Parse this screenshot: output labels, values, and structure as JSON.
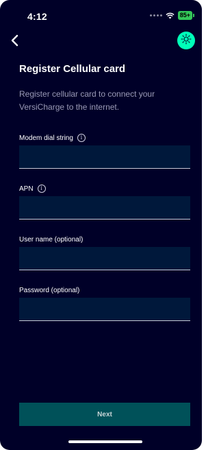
{
  "status_bar": {
    "time": "4:12",
    "battery": "85+"
  },
  "icons": {
    "back": "chevron-left-icon",
    "brightness": "sun-icon",
    "info": "info-icon"
  },
  "colors": {
    "background": "#000028",
    "accent": "#00ffb9",
    "button": "#005159",
    "input_background": "#00183b",
    "description_text": "#9a9ab5"
  },
  "page": {
    "title": "Register Cellular card",
    "description": "Register cellular card to connect your VersiCharge to the internet."
  },
  "form": {
    "modem_dial_string": {
      "label": "Modem dial string",
      "value": "",
      "info": "i"
    },
    "apn": {
      "label": "APN",
      "value": "",
      "info": "i"
    },
    "user_name": {
      "label": "User name (optional)",
      "value": ""
    },
    "password": {
      "label": "Password (optional)",
      "value": ""
    }
  },
  "actions": {
    "next_label": "Next"
  }
}
